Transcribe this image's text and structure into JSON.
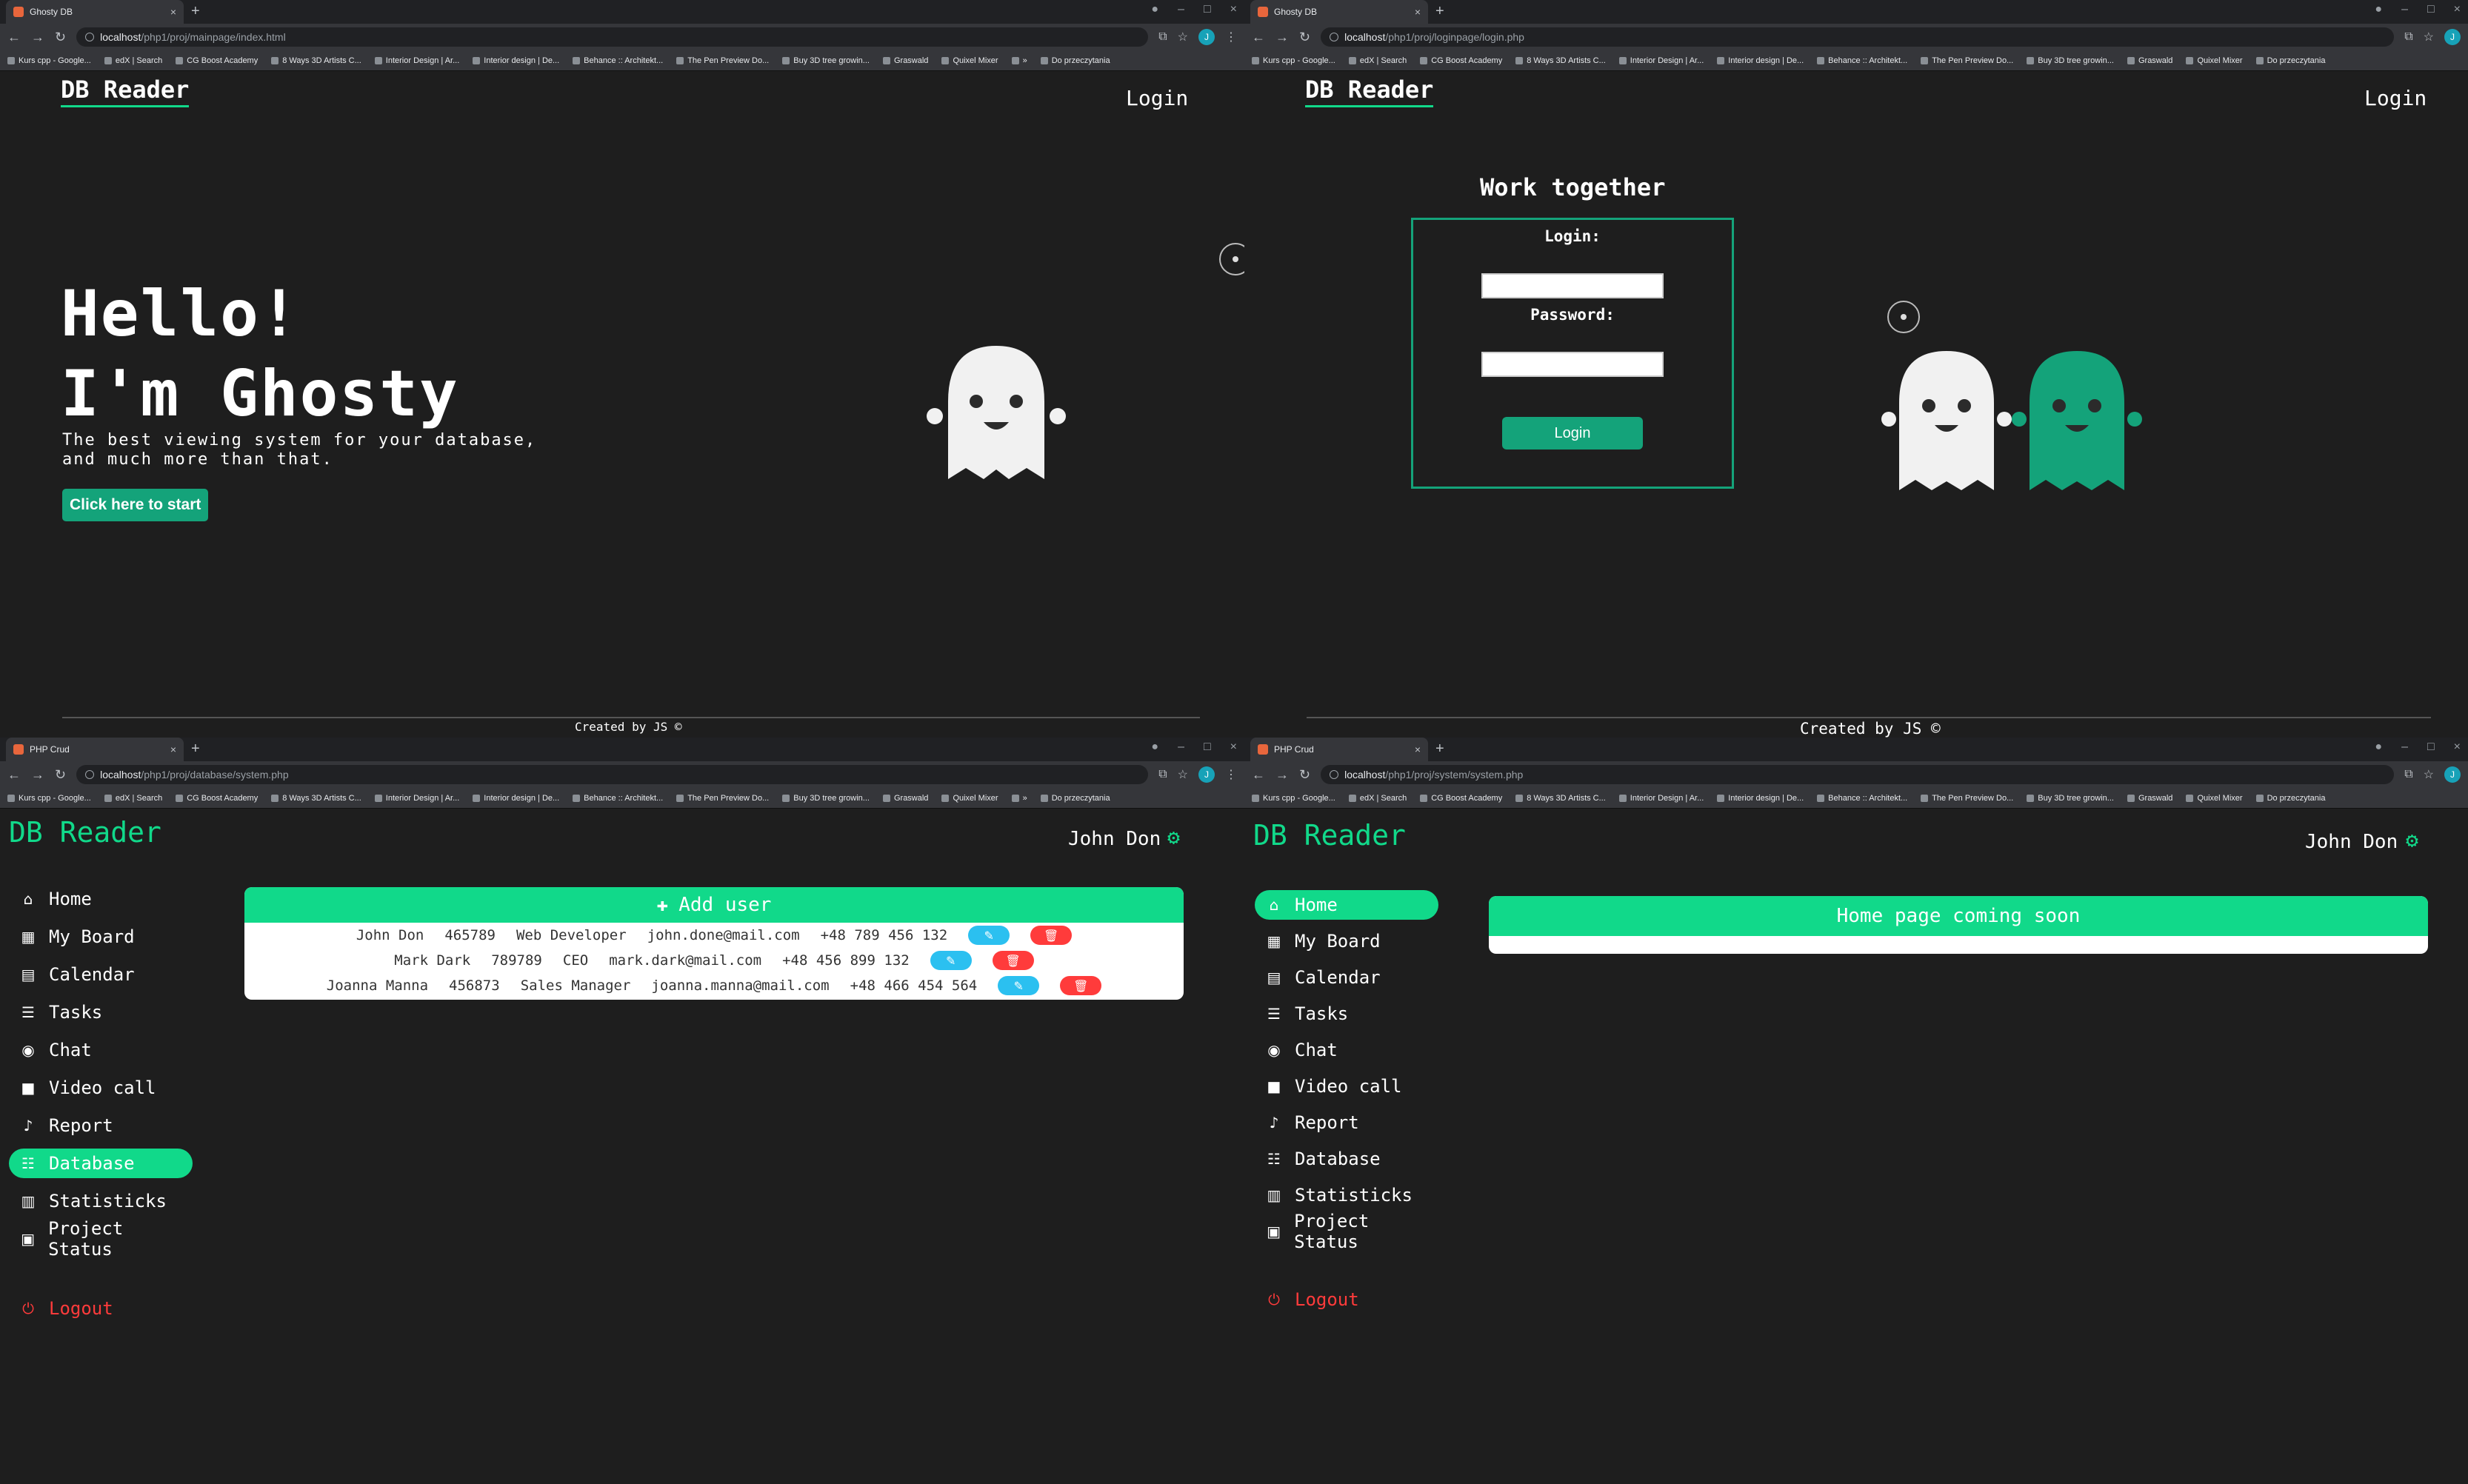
{
  "windows": {
    "landing": {
      "tab_title": "Ghosty DB",
      "url_host": "localhost",
      "url_path": "/php1/proj/mainpage/index.html",
      "logo": "DB Reader",
      "nav_login": "Login",
      "hero_line1": "Hello!",
      "hero_line2": "I'm Ghosty",
      "sub_line1": "The best viewing system for your database,",
      "sub_line2": "and much more than that.",
      "cta": "Click here to start",
      "footer": "Created by JS ©"
    },
    "login": {
      "tab_title": "Ghosty DB",
      "url_host": "localhost",
      "url_path": "/php1/proj/loginpage/login.php",
      "logo": "DB Reader",
      "nav_login": "Login",
      "heading": "Work together",
      "login_label": "Login:",
      "password_label": "Password:",
      "button": "Login",
      "footer": "Created by JS ©"
    },
    "database": {
      "tab_title": "PHP Crud",
      "url_host": "localhost",
      "url_path": "/php1/proj/database/system.php",
      "logo": "DB Reader",
      "user": "John Don",
      "add_user": "Add user",
      "rows": [
        {
          "name": "John Don",
          "id": "465789",
          "role": "Web Developer",
          "email": "john.done@mail.com",
          "phone": "+48 789 456 132"
        },
        {
          "name": "Mark Dark",
          "id": "789789",
          "role": "CEO",
          "email": "mark.dark@mail.com",
          "phone": "+48 456 899 132"
        },
        {
          "name": "Joanna Manna",
          "id": "456873",
          "role": "Sales Manager",
          "email": "joanna.manna@mail.com",
          "phone": "+48 466 454 564"
        }
      ]
    },
    "home": {
      "tab_title": "PHP Crud",
      "url_host": "localhost",
      "url_path": "/php1/proj/system/system.php",
      "logo": "DB Reader",
      "user": "John Don",
      "banner": "Home page coming soon"
    }
  },
  "sidebar": {
    "items": [
      {
        "label": "Home",
        "icon": "home-icon"
      },
      {
        "label": "My Board",
        "icon": "grid-icon"
      },
      {
        "label": "Calendar",
        "icon": "calendar-icon"
      },
      {
        "label": "Tasks",
        "icon": "list-icon"
      },
      {
        "label": "Chat",
        "icon": "chat-icon"
      },
      {
        "label": "Video call",
        "icon": "video-icon"
      },
      {
        "label": "Report",
        "icon": "bell-icon"
      },
      {
        "label": "Database",
        "icon": "database-icon"
      },
      {
        "label": "Statisticks",
        "icon": "stats-icon"
      },
      {
        "label": "Project Status",
        "icon": "archive-icon"
      }
    ],
    "logout": "Logout"
  },
  "bookmarks": [
    "Kurs cpp - Google...",
    "edX | Search",
    "CG Boost Academy",
    "8 Ways 3D Artists C...",
    "Interior Design | Ar...",
    "Interior design | De...",
    "Behance :: Architekt...",
    "The Pen Preview Do...",
    "Buy 3D tree growin...",
    "Graswald",
    "Quixel Mixer",
    "»",
    "Do przeczytania"
  ],
  "colors": {
    "accent": "#11d98a",
    "accent_dark": "#14a37a",
    "danger": "#ff3b3b",
    "edit": "#2bc0f0",
    "bg": "#1e1e1e"
  }
}
